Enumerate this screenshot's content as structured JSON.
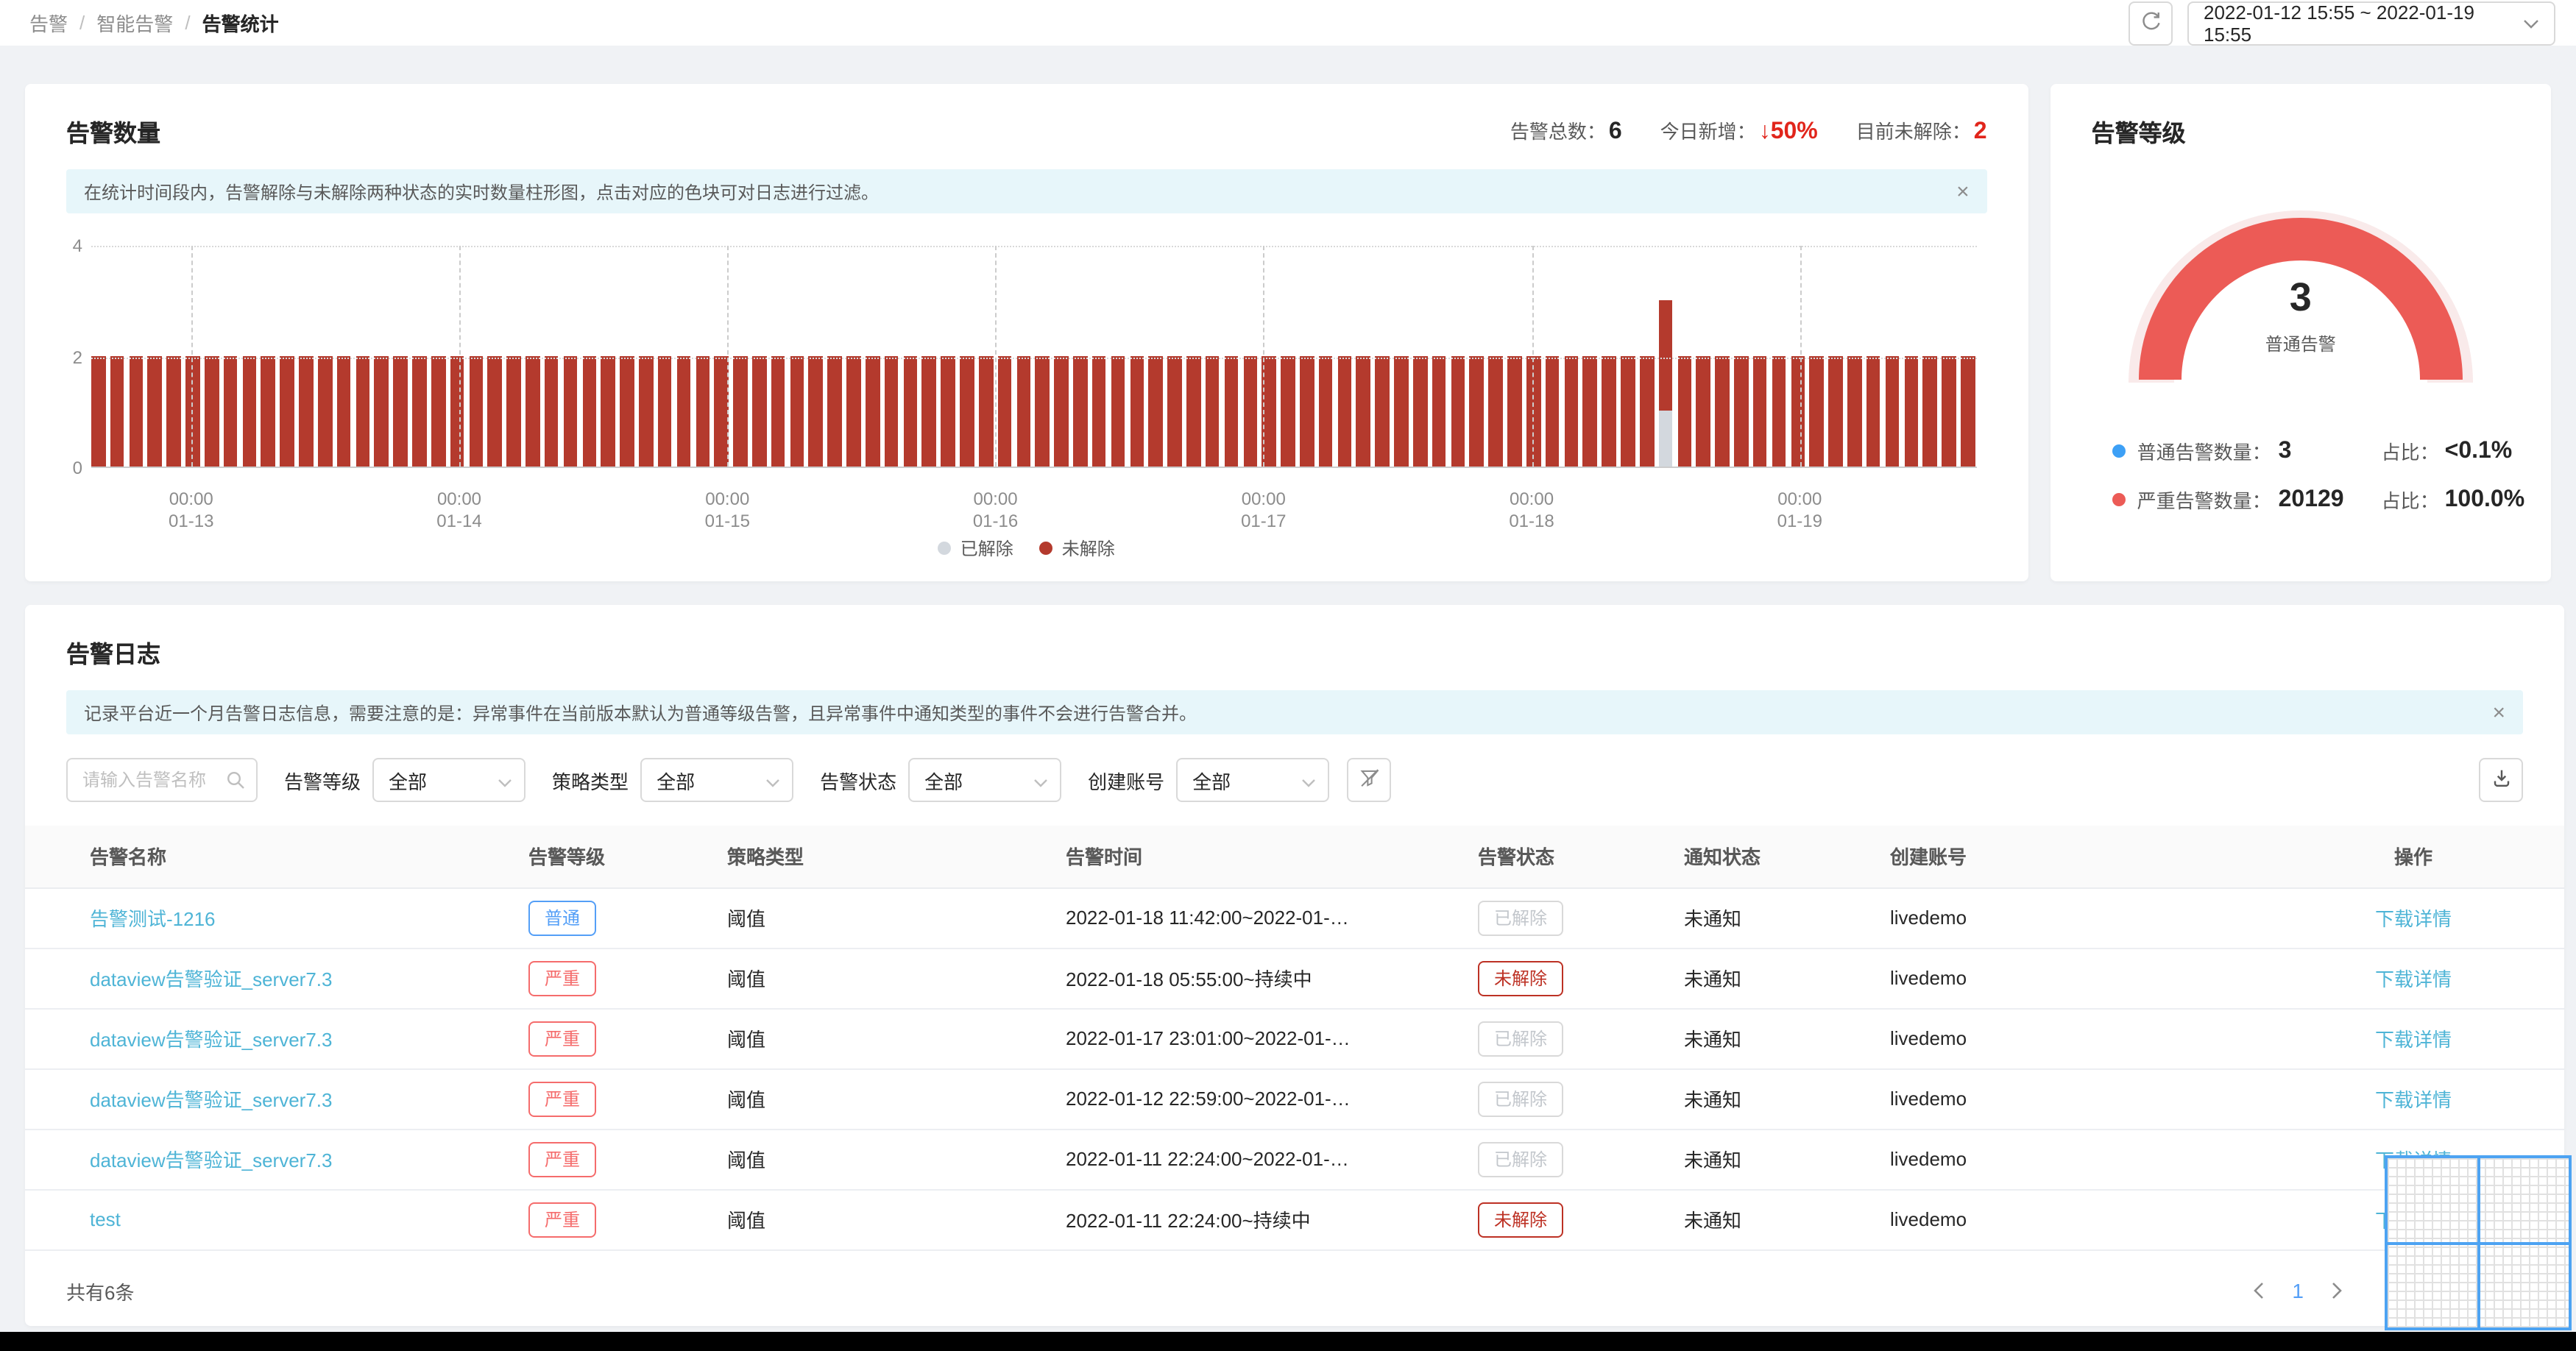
{
  "breadcrumb": {
    "items": [
      "告警",
      "智能告警",
      "告警统计"
    ],
    "separator": "/"
  },
  "header": {
    "date_range": "2022-01-12 15:55 ~ 2022-01-19 15:55"
  },
  "icons": {
    "close": "×"
  },
  "colors": {
    "page_bg": "#f0f2f5",
    "info_banner_bg": "#e7f6fa",
    "link": "#4eb4d6",
    "badge_normal_blue": "#549ff7",
    "badge_severe_red": "#f56c6c",
    "badge_unresolved_red": "#bd3124",
    "bar_unresolved": "#b43a2d",
    "bar_resolved": "#d3d8de",
    "gauge_red": "#ec5b56",
    "gauge_track": "#f9eaea",
    "gauge_normal_blue": "#3da0f6",
    "stat_red": "#e1251b"
  },
  "alert_count_card": {
    "title": "告警数量",
    "stats": [
      {
        "label": "告警总数：",
        "value": "6",
        "red": false
      },
      {
        "label": "今日新增：",
        "value": "↓50%",
        "red": true
      },
      {
        "label": "目前未解除：",
        "value": "2",
        "red": true
      }
    ],
    "banner": "在统计时间段内，告警解除与未解除两种状态的实时数量柱形图，点击对应的色块可对日志进行过滤。"
  },
  "chart_data": {
    "type": "bar",
    "stacked": true,
    "title": "告警数量",
    "ylim": [
      0,
      4
    ],
    "yticks": [
      0,
      2,
      4
    ],
    "grid": true,
    "legend_position": "bottom",
    "x_ticks": [
      {
        "time": "00:00",
        "date": "01-13"
      },
      {
        "time": "00:00",
        "date": "01-14"
      },
      {
        "time": "00:00",
        "date": "01-15"
      },
      {
        "time": "00:00",
        "date": "01-16"
      },
      {
        "time": "00:00",
        "date": "01-17"
      },
      {
        "time": "00:00",
        "date": "01-18"
      },
      {
        "time": "00:00",
        "date": "01-19"
      }
    ],
    "series": [
      {
        "name": "已解除",
        "color": "#d3d8de"
      },
      {
        "name": "未解除",
        "color": "#b43a2d"
      }
    ],
    "bars": {
      "count": 100,
      "default_values": {
        "已解除": 0,
        "未解除": 2
      },
      "spike_index": 83,
      "spike_values": {
        "已解除": 1,
        "未解除": 2
      },
      "note": "x axis spans 2022-01-12 15:55 to 2022-01-19 15:55; all bars = 2 unresolved except one spike near 01-18 noon with 1 resolved + 2 unresolved (total 3)"
    }
  },
  "level_card": {
    "title": "告警等级",
    "gauge_value": "3",
    "gauge_label": "普通告警",
    "legend": [
      {
        "dot": "#3da0f6",
        "label": "普通告警数量：",
        "value": "3",
        "ratio_label": "占比：",
        "ratio": "<0.1%"
      },
      {
        "dot": "#ec5b56",
        "label": "严重告警数量：",
        "value": "20129",
        "ratio_label": "占比：",
        "ratio": "100.0%"
      }
    ]
  },
  "log_card": {
    "title": "告警日志",
    "banner": "记录平台近一个月告警日志信息，需要注意的是：异常事件在当前版本默认为普通等级告警，且异常事件中通知类型的事件不会进行告警合并。",
    "filters": {
      "search_placeholder": "请输入告警名称",
      "selects": [
        {
          "label": "告警等级",
          "value": "全部"
        },
        {
          "label": "策略类型",
          "value": "全部"
        },
        {
          "label": "告警状态",
          "value": "全部"
        },
        {
          "label": "创建账号",
          "value": "全部"
        }
      ]
    },
    "table": {
      "headers": [
        "告警名称",
        "告警等级",
        "策略类型",
        "告警时间",
        "告警状态",
        "通知状态",
        "创建账号",
        "操作"
      ],
      "rows": [
        {
          "name": "告警测试-1216",
          "level": "普通",
          "level_type": "blue",
          "policy": "阈值",
          "time": "2022-01-18 11:42:00~2022-01-…",
          "status": "已解除",
          "status_type": "resolved",
          "notify": "未通知",
          "account": "livedemo",
          "action": "下载详情"
        },
        {
          "name": "dataview告警验证_server7.3",
          "level": "严重",
          "level_type": "red",
          "policy": "阈值",
          "time": "2022-01-18 05:55:00~持续中",
          "status": "未解除",
          "status_type": "unresolved",
          "notify": "未通知",
          "account": "livedemo",
          "action": "下载详情"
        },
        {
          "name": "dataview告警验证_server7.3",
          "level": "严重",
          "level_type": "red",
          "policy": "阈值",
          "time": "2022-01-17 23:01:00~2022-01-…",
          "status": "已解除",
          "status_type": "resolved",
          "notify": "未通知",
          "account": "livedemo",
          "action": "下载详情"
        },
        {
          "name": "dataview告警验证_server7.3",
          "level": "严重",
          "level_type": "red",
          "policy": "阈值",
          "time": "2022-01-12 22:59:00~2022-01-…",
          "status": "已解除",
          "status_type": "resolved",
          "notify": "未通知",
          "account": "livedemo",
          "action": "下载详情"
        },
        {
          "name": "dataview告警验证_server7.3",
          "level": "严重",
          "level_type": "red",
          "policy": "阈值",
          "time": "2022-01-11 22:24:00~2022-01-…",
          "status": "已解除",
          "status_type": "resolved",
          "notify": "未通知",
          "account": "livedemo",
          "action": "下载详情"
        },
        {
          "name": "test",
          "level": "严重",
          "level_type": "red",
          "policy": "阈值",
          "time": "2022-01-11 22:24:00~持续中",
          "status": "未解除",
          "status_type": "unresolved",
          "notify": "未通知",
          "account": "livedemo",
          "action": "下载详情"
        }
      ]
    },
    "footer": {
      "total": "共有6条",
      "page": "1"
    }
  }
}
